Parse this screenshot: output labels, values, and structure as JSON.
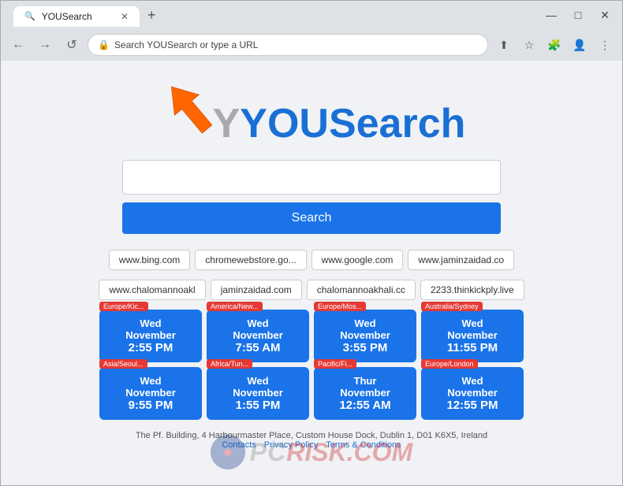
{
  "browser": {
    "tab_title": "YOUSearch",
    "tab_favicon": "🔍",
    "new_tab_label": "+",
    "address_placeholder": "Search YOUSearch or type a URL",
    "address_value": "Search YOUSearch or type a URL",
    "nav_back": "←",
    "nav_forward": "→",
    "nav_refresh": "↺",
    "title_minimize": "—",
    "title_maximize": "□",
    "title_close": "✕"
  },
  "page": {
    "logo": "YOUSearch",
    "logo_prefix": "",
    "search_placeholder": "",
    "search_button_label": "Search",
    "quick_links": [
      "www.bing.com",
      "chromewebstore.go...",
      "www.google.com",
      "www.jaminzaidad.co",
      "www.chalomannoakl",
      "jaminzaidad.com",
      "chalomannoakhali.cc",
      "2233.thinkickply.live"
    ],
    "clocks_row1": [
      {
        "tz": "Europe/Kic...",
        "day": "Wed November",
        "time": "2:55 PM"
      },
      {
        "tz": "America/New...",
        "day": "Wed November",
        "time": "7:55 AM"
      },
      {
        "tz": "Europe/Mos...",
        "day": "Wed November",
        "time": "3:55 PM"
      },
      {
        "tz": "Australia/Sydney",
        "day": "Wed November",
        "time": "11:55 PM"
      }
    ],
    "clocks_row2": [
      {
        "tz": "Asia/Seoul...",
        "day": "Wed November",
        "time": "9:55 PM"
      },
      {
        "tz": "Africa/Tun...",
        "day": "Wed November",
        "time": "1:55 PM"
      },
      {
        "tz": "Pacific/Fi...",
        "day": "Thur November",
        "time": "12:55 AM"
      },
      {
        "tz": "Europe/London",
        "day": "Wed November",
        "time": "12:55 PM"
      }
    ],
    "footer_address": "The Pf. Building, 4 Harbourmaster Place, Custom House Dock, Dublin 1, D01 K6X5, Ireland",
    "footer_links": [
      "Contacts",
      "Privacy Policy",
      "Terms & Conditions"
    ],
    "watermark": "RISK.COM"
  }
}
